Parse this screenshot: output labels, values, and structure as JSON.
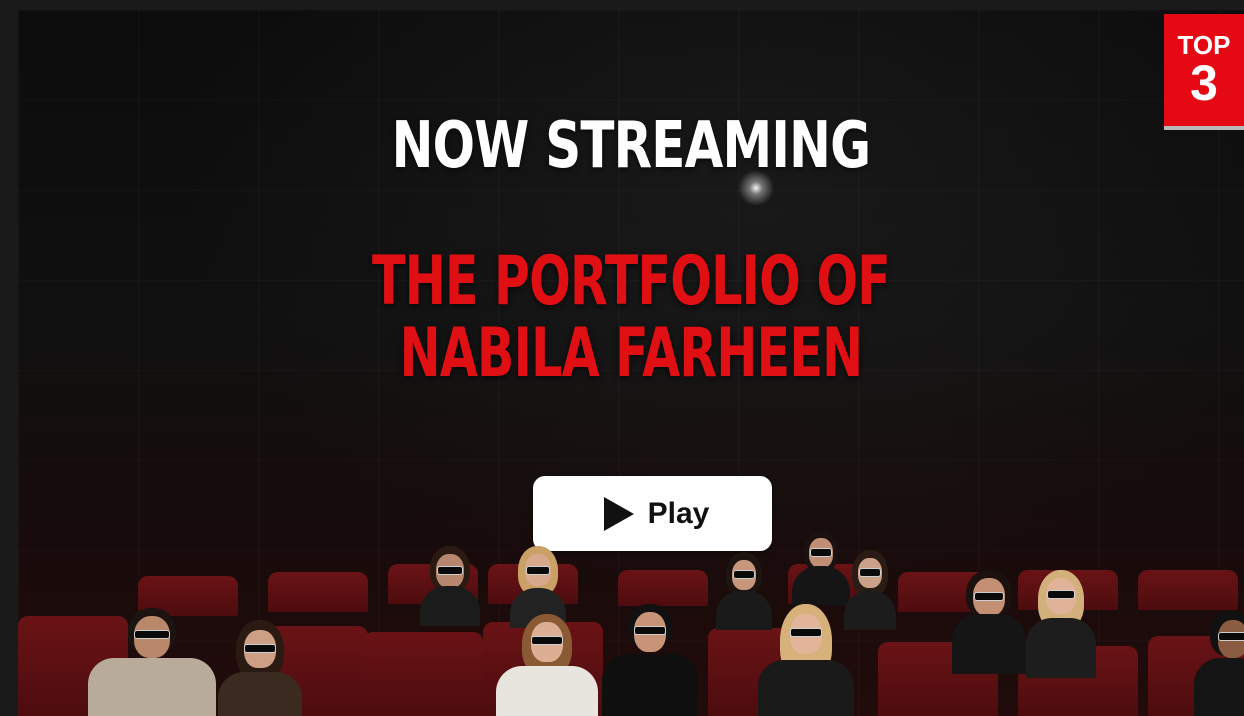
{
  "hero": {
    "headline": "NOW STREAMING",
    "title_line1": "THE PORTFOLIO OF",
    "title_line2": "NABILA FARHEEN",
    "play_label": "Play",
    "play_icon": "play-icon",
    "background_scene": "cinema-audience-with-3d-glasses"
  },
  "badge": {
    "label": "TOP",
    "rank": "3"
  },
  "colors": {
    "accent_red": "#e00f14",
    "badge_red": "#e50914",
    "button_bg": "#ffffff",
    "headline_text": "#ffffff"
  }
}
